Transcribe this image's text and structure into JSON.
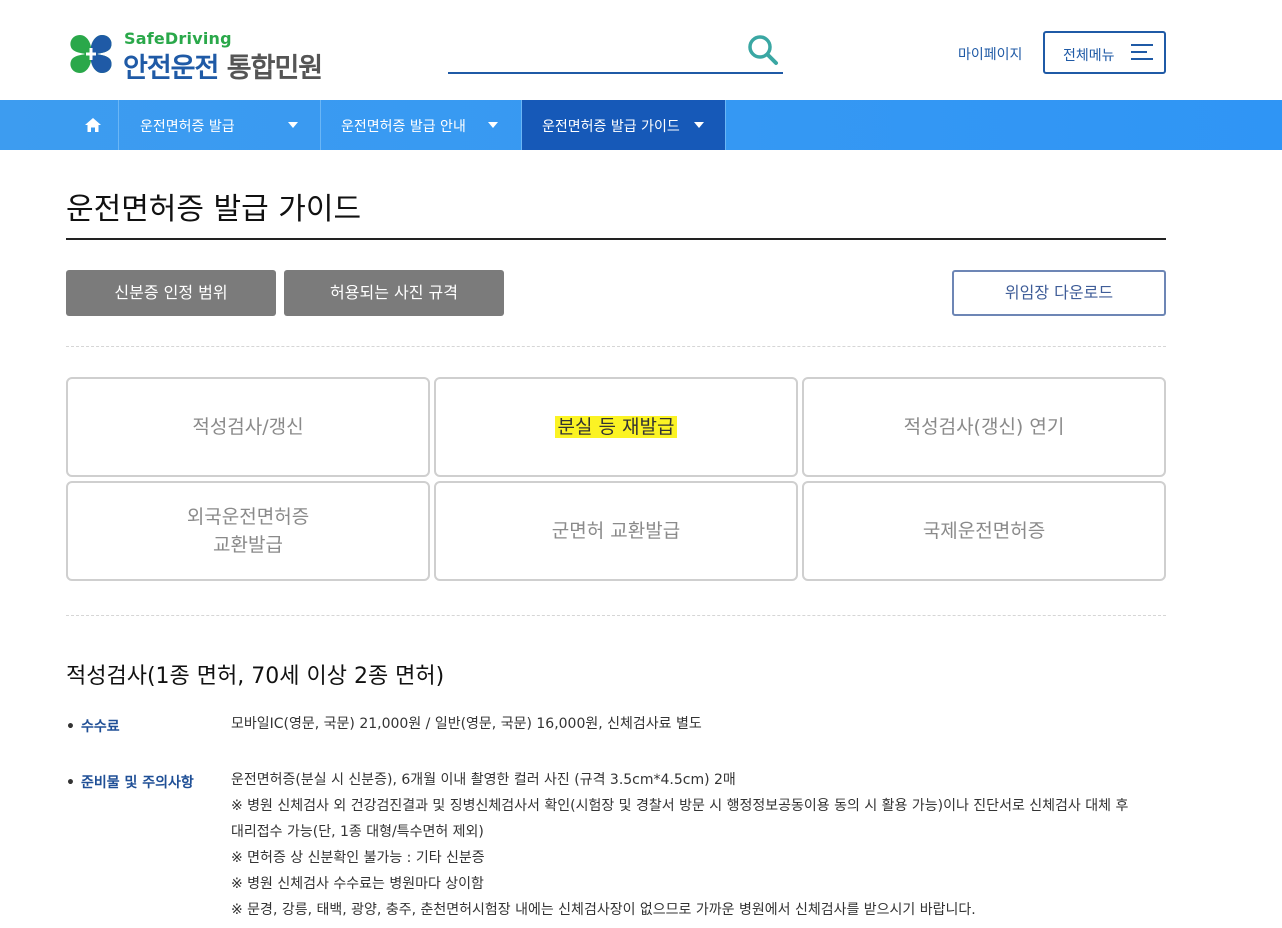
{
  "header": {
    "logo_sub": "SafeDriving",
    "logo_main_1": "안전운전",
    "logo_main_2": "통합민원",
    "search_placeholder": "",
    "mypage_label": "마이페이지",
    "allmenu_label": "전체메뉴"
  },
  "nav": {
    "home_icon": "home-icon",
    "items": [
      {
        "label": "운전면허증 발급"
      },
      {
        "label": "운전면허증 발급 안내"
      },
      {
        "label": "운전면허증 발급 가이드"
      }
    ]
  },
  "page": {
    "title": "운전면허증 발급 가이드",
    "btn_id_scope": "신분증 인정 범위",
    "btn_photo_spec": "허용되는 사진 규격",
    "btn_download": "위임장 다운로드"
  },
  "tiles": [
    {
      "label": "적성검사/갱신"
    },
    {
      "label": "분실 등 재발급"
    },
    {
      "label": "적성검사(갱신) 연기"
    },
    {
      "label": "외국운전면허증\n교환발급"
    },
    {
      "label": "군면허 교환발급"
    },
    {
      "label": "국제운전면허증"
    }
  ],
  "section": {
    "title": "적성검사(1종 면허, 70세 이상 2종 면허)",
    "fee_label": "수수료",
    "fee_text": "모바일IC(영문, 국문) 21,000원 / 일반(영문, 국문) 16,000원, 신체검사료 별도",
    "prep_label": "준비물 및 주의사항",
    "prep_lines": [
      "운전면허증(분실 시 신분증), 6개월 이내 촬영한 컬러 사진 (규격 3.5cm*4.5cm) 2매",
      "※ 병원 신체검사 외 건강검진결과 및 징병신체검사서 확인(시험장 및 경찰서 방문 시 행정정보공동이용 동의 시 활용 가능)이나 진단서로 신체검사 대체 후",
      "대리접수 가능(단, 1종 대형/특수면허 제외)",
      "※ 면허증 상 신분확인 불가능 : 기타 신분증",
      "※ 병원 신체검사 수수료는 병원마다 상이함",
      "※ 문경, 강릉, 태백, 광양, 충주, 춘천면허시험장 내에는 신체검사장이 없으므로 가까운 병원에서 신체검사를 받으시기 바랍니다."
    ]
  },
  "colors": {
    "brand_blue": "#1f5aa6",
    "nav_blue": "#3d9cf0",
    "nav_active": "#1659b8",
    "logo_green": "#2aa84a",
    "highlight": "#fbf324"
  }
}
